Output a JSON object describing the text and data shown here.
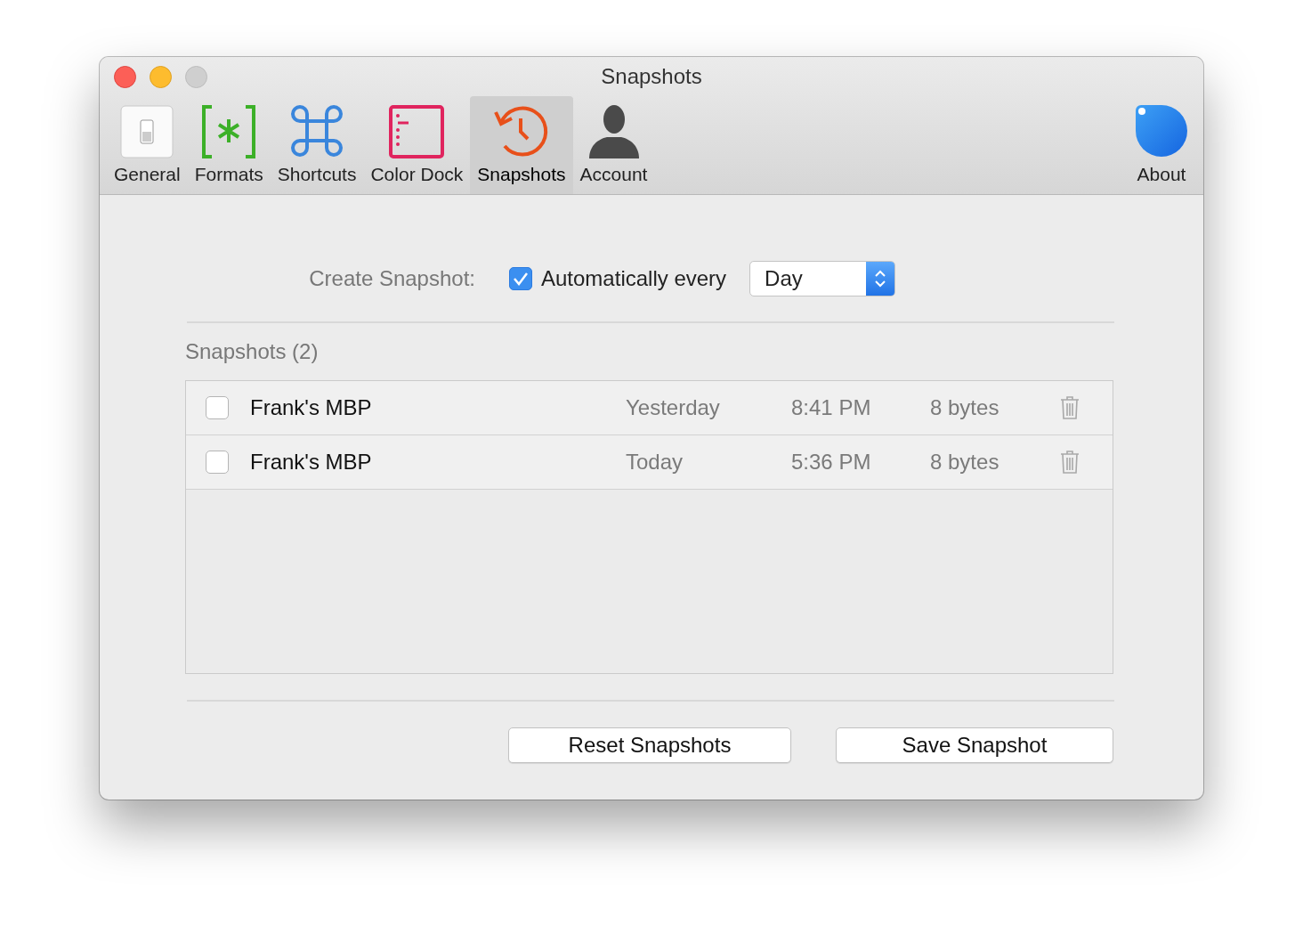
{
  "window": {
    "title": "Snapshots"
  },
  "toolbar": {
    "items": [
      {
        "kind": "general",
        "label": "General",
        "selected": false
      },
      {
        "kind": "formats",
        "label": "Formats",
        "selected": false
      },
      {
        "kind": "shortcuts",
        "label": "Shortcuts",
        "selected": false
      },
      {
        "kind": "color_dock",
        "label": "Color Dock",
        "selected": false
      },
      {
        "kind": "snapshots",
        "label": "Snapshots",
        "selected": true
      },
      {
        "kind": "account",
        "label": "Account",
        "selected": false
      }
    ],
    "about": {
      "kind": "about",
      "label": "About",
      "selected": false
    }
  },
  "create_snapshot": {
    "label": "Create Snapshot:",
    "checkbox": {
      "label": "Automatically every",
      "checked": true
    },
    "interval": {
      "value": "Day"
    }
  },
  "snapshots": {
    "heading": "Snapshots (2)",
    "rows": [
      {
        "checked": false,
        "name": "Frank's MBP",
        "date": "Yesterday",
        "time": "8:41 PM",
        "size": "8 bytes"
      },
      {
        "checked": false,
        "name": "Frank's MBP",
        "date": "Today",
        "time": "5:36 PM",
        "size": "8 bytes"
      }
    ]
  },
  "buttons": [
    {
      "label": "Reset Snapshots"
    },
    {
      "label": "Save Snapshot"
    }
  ]
}
